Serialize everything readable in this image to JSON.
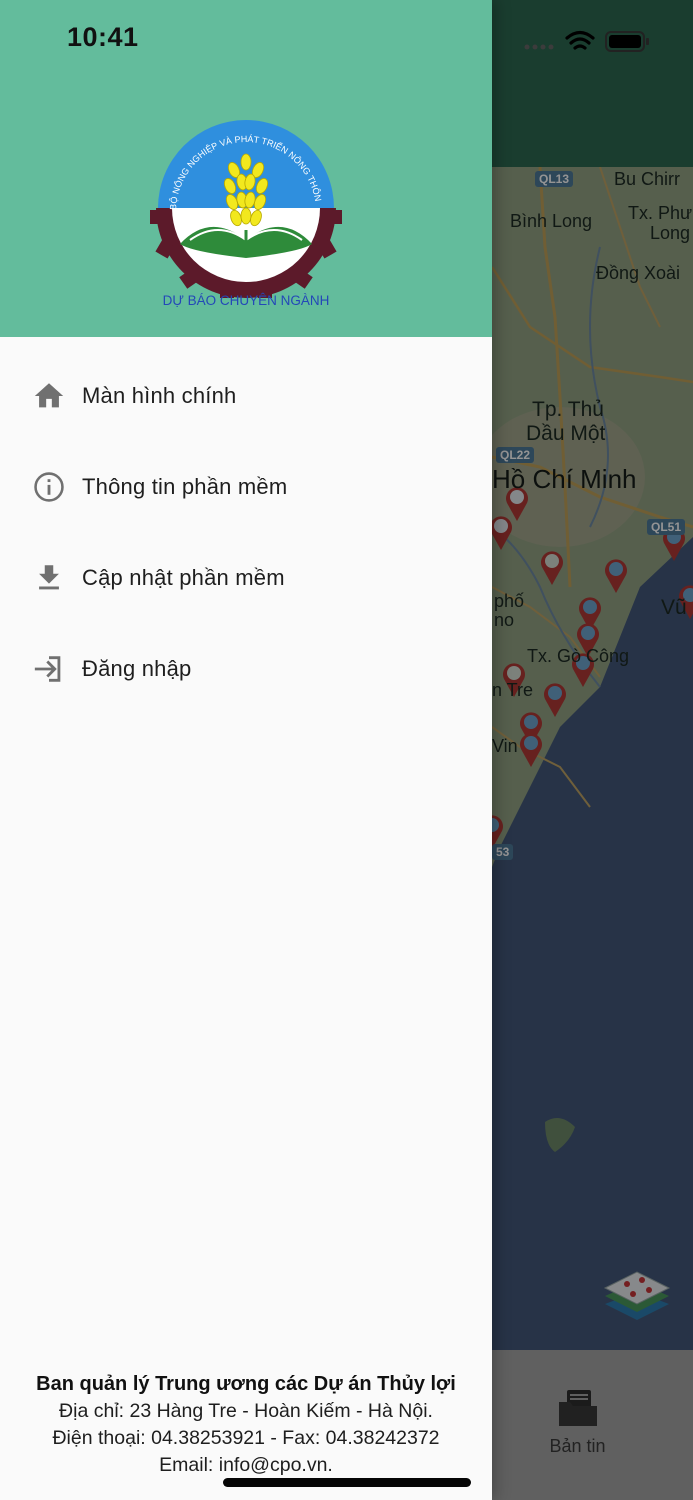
{
  "status_bar": {
    "time": "10:41",
    "icons": [
      "signal-dots-icon",
      "wifi-icon",
      "battery-icon"
    ]
  },
  "colors": {
    "drawer_header": "#63bc9c",
    "app_header_behind": "#2e6a52",
    "drawer_bg": "#fafafa",
    "menu_icon": "#707070",
    "map_sea": "#44597a"
  },
  "logo": {
    "arc_text": "BỘ NÔNG NGHIỆP VÀ PHÁT TRIỂN NÔNG THÔN",
    "caption": "DỰ BÁO CHUYÊN NGÀNH"
  },
  "menu": {
    "items": [
      {
        "icon": "home-icon",
        "label": "Màn hình chính"
      },
      {
        "icon": "info-icon",
        "label": "Thông tin phần mềm"
      },
      {
        "icon": "download-icon",
        "label": "Cập nhật phần mềm"
      },
      {
        "icon": "login-icon",
        "label": "Đăng nhập"
      }
    ]
  },
  "footer": {
    "org_name": "Ban quản lý Trung ương các Dự án Thủy lợi",
    "address": "Địa chỉ: 23 Hàng Tre - Hoàn Kiếm - Hà Nội.",
    "phone": "Điện thoại: 04.38253921 - Fax: 04.38242372",
    "email": "Email: info@cpo.vn."
  },
  "background_app": {
    "map_labels": {
      "bu_chirr": "Bu Chirr",
      "binh_long": "Bình Long",
      "tx_phu_long_1": "Tx. Phư",
      "tx_phu_long_2": "Long",
      "dong_xoai": "Đồng Xoài",
      "tp_thu_dau_mot_1": "Tp. Thủ",
      "tp_thu_dau_mot_2": "Dầu Một",
      "ho_chi_minh": "Hồ Chí Minh",
      "pho": "phố",
      "no": "no",
      "tx_go_cong": "Tx. Gò Công",
      "vu": "Vũ",
      "n_tre": "n Tre",
      "vin": "Vin"
    },
    "road_badges": {
      "ql13": "QL13",
      "ql22": "QL22",
      "ql51": "QL51",
      "r53": "53"
    },
    "bottom_nav": {
      "news_label": "Bản tin",
      "news_icon": "folder-icon"
    },
    "fab_icon": "map-layers-icon"
  }
}
